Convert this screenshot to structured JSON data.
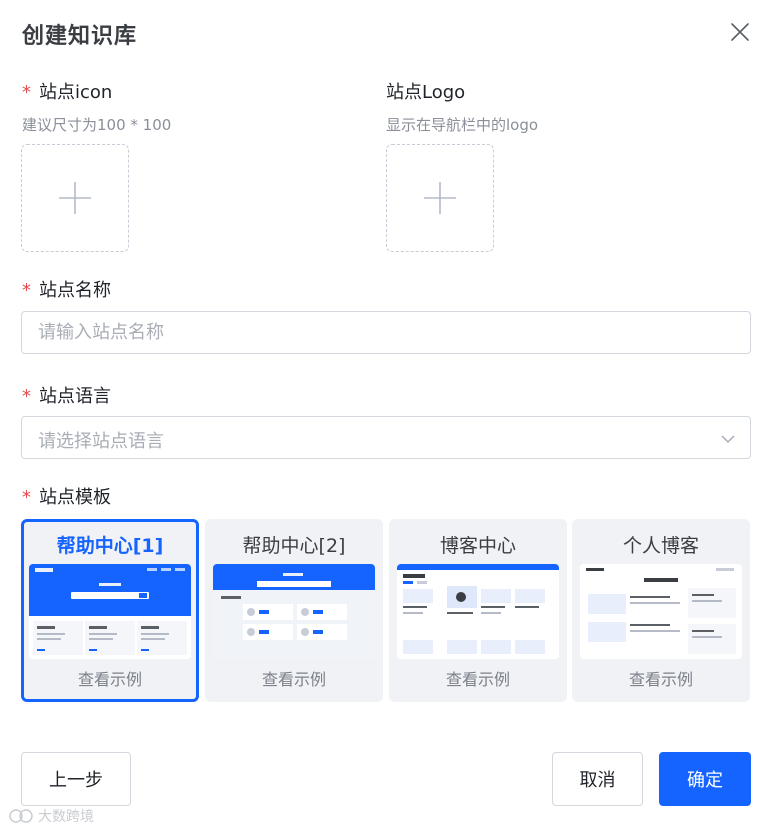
{
  "dialog": {
    "title": "创建知识库"
  },
  "icon_field": {
    "required_mark": "*",
    "label": "站点icon",
    "hint": "建议尺寸为100 * 100"
  },
  "logo_field": {
    "label": "站点Logo",
    "hint": "显示在导航栏中的logo"
  },
  "name_field": {
    "required_mark": "*",
    "label": "站点名称",
    "placeholder": "请输入站点名称",
    "value": ""
  },
  "language_field": {
    "required_mark": "*",
    "label": "站点语言",
    "placeholder": "请选择站点语言"
  },
  "template_field": {
    "required_mark": "*",
    "label": "站点模板",
    "templates": [
      {
        "name": "帮助中心[1]",
        "link": "查看示例",
        "selected": true
      },
      {
        "name": "帮助中心[2]",
        "link": "查看示例",
        "selected": false
      },
      {
        "name": "博客中心",
        "link": "查看示例",
        "selected": false
      },
      {
        "name": "个人博客",
        "link": "查看示例",
        "selected": false
      }
    ]
  },
  "footer": {
    "prev_label": "上一步",
    "cancel_label": "取消",
    "confirm_label": "确定"
  },
  "watermark": {
    "text": "大数跨境"
  },
  "colors": {
    "primary": "#1664ff",
    "required": "#e5484d",
    "template_bg": "#f1f2f5"
  }
}
